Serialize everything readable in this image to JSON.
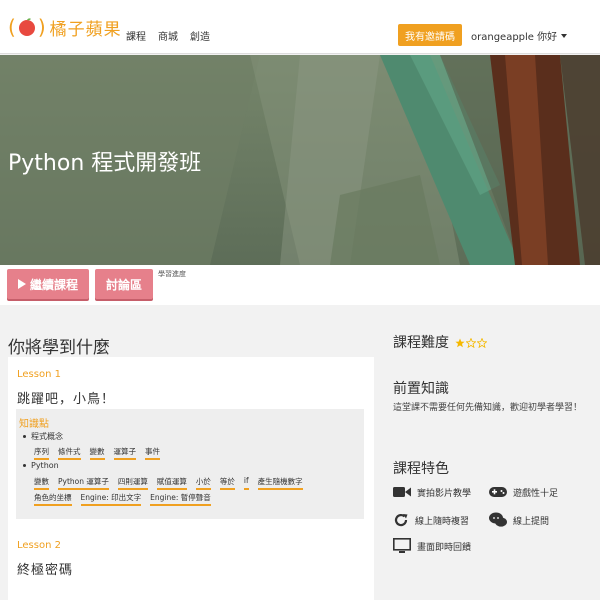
{
  "header": {
    "logo_text": "橘子蘋果",
    "nav": [
      "課程",
      "商城",
      "創造"
    ],
    "invite_label": "我有邀請碼",
    "user_label": "orangeapple 你好"
  },
  "hero": {
    "title": "Python 程式開發班"
  },
  "actions": {
    "continue_label": "繼續課程",
    "discuss_label": "討論區",
    "progress_label": "學習進度"
  },
  "main": {
    "learn_title": "你將學到什麼",
    "lessons": [
      {
        "label": "Lesson 1",
        "name": "跳躍吧，小鳥！",
        "knowledge_title": "知識點",
        "groups": [
          {
            "name": "程式概念",
            "tags": [
              "序列",
              "條件式",
              "變數",
              "運算子",
              "事件"
            ]
          },
          {
            "name": "Python",
            "tags": [
              "變數",
              "Python 運算子",
              "四則運算",
              "賦值運算",
              "小於",
              "等於",
              "if",
              "產生隨機數字",
              "角色的坐標",
              "Engine: 印出文字",
              "Engine: 暫停聲音"
            ]
          }
        ]
      },
      {
        "label": "Lesson 2",
        "name": "終極密碼"
      }
    ]
  },
  "sidebar": {
    "difficulty_title": "課程難度",
    "difficulty_stars": 1,
    "difficulty_max": 3,
    "prereq_title": "前置知識",
    "prereq_text": "這堂課不需要任何先備知識，歡迎初學者學習！",
    "features_title": "課程特色",
    "features": [
      {
        "icon": "video-camera-icon",
        "label": "實拍影片教學"
      },
      {
        "icon": "gamepad-icon",
        "label": "遊戲性十足"
      },
      {
        "icon": "refresh-icon",
        "label": "線上隨時複習"
      },
      {
        "icon": "chat-icon",
        "label": "線上提問"
      },
      {
        "icon": "monitor-icon",
        "label": "畫面即時回饋"
      }
    ]
  },
  "colors": {
    "accent": "#f0a020",
    "button_red": "#e6808b",
    "hero_bg": "#6e7e64"
  }
}
